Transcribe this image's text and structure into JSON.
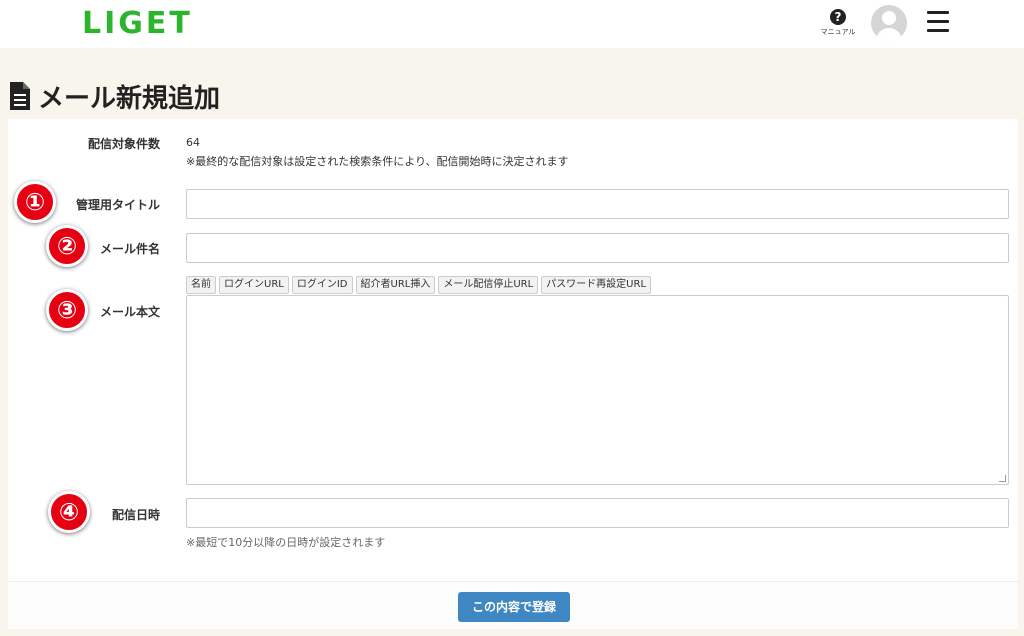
{
  "header": {
    "logo": "LIGET",
    "help_label": "マニュアル",
    "help_symbol": "?"
  },
  "page": {
    "title": "メール新規追加"
  },
  "form": {
    "target_count": {
      "label": "配信対象件数",
      "value": "64",
      "note": "※最終的な配信対象は設定された検索条件により、配信開始時に決定されます"
    },
    "admin_title": {
      "badge": "①",
      "label": "管理用タイトル",
      "value": ""
    },
    "mail_subject": {
      "badge": "②",
      "label": "メール件名",
      "value": ""
    },
    "mail_body": {
      "badge": "③",
      "label": "メール本文",
      "value": "",
      "tags": [
        "名前",
        "ログインURL",
        "ログインID",
        "紹介者URL挿入",
        "メール配信停止URL",
        "パスワード再設定URL"
      ]
    },
    "send_datetime": {
      "badge": "④",
      "label": "配信日時",
      "value": "",
      "note": "※最短で10分以降の日時が設定されます"
    },
    "submit_label": "この内容で登録"
  },
  "colors": {
    "brand": "#2cb52c",
    "accent": "#3f87c2",
    "badge": "#e60012",
    "background": "#f8f6ec"
  }
}
